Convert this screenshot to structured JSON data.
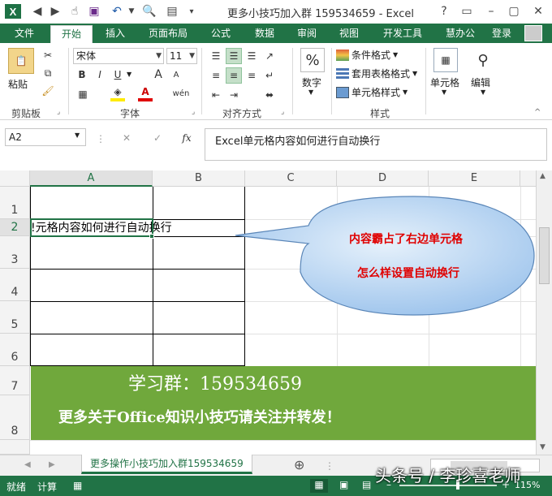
{
  "app": {
    "logo": "X",
    "title": "更多小技巧加入群 159534659 - Excel",
    "window_buttons": [
      "?",
      "▭",
      "–",
      "▢",
      "✕"
    ]
  },
  "tabs": [
    "文件",
    "开始",
    "插入",
    "页面布局",
    "公式",
    "数据",
    "审阅",
    "视图",
    "开发工具",
    "慧办公"
  ],
  "active_tab": "开始",
  "account": {
    "login": "登录"
  },
  "ribbon": {
    "clipboard": {
      "paste": "粘贴",
      "group": "剪贴板"
    },
    "font": {
      "name": "宋体",
      "size": "11",
      "bold": "B",
      "italic": "I",
      "underline": "U",
      "grow": "A",
      "shrink": "A",
      "phonetic": "wén",
      "group": "字体"
    },
    "alignment": {
      "group": "对齐方式"
    },
    "number": {
      "label": "数字",
      "icon_text": "%"
    },
    "styles": {
      "conditional": "条件格式",
      "table": "套用表格格式",
      "cell_styles": "单元格样式",
      "group": "样式"
    },
    "cells": {
      "label": "单元格"
    },
    "editing": {
      "label": "编辑"
    }
  },
  "formula_bar": {
    "name_box": "A2",
    "cancel": "✕",
    "enter": "✓",
    "fx": "fx",
    "content": "Excel单元格内容如何进行自动换行"
  },
  "grid": {
    "columns": [
      "A",
      "B",
      "C",
      "D",
      "E"
    ],
    "rows": [
      "1",
      "2",
      "3",
      "4",
      "5",
      "6",
      "7",
      "8"
    ],
    "a2_visible_text": "!元格内容如何进行自动换行",
    "banner_line1": "学习群：159534659",
    "banner_line2": "更多关于Office知识小技巧请关注并转发！"
  },
  "callout": {
    "line1": "内容霸占了右边单元格",
    "line2": "怎么样设置自动换行"
  },
  "sheet_tabs": {
    "active": "更多操作小技巧加入群159534659",
    "add": "⊕"
  },
  "status": {
    "ready": "就绪",
    "calc": "计算",
    "zoom": "115%"
  },
  "watermark": "头条号 / 李珍喜老师",
  "colors": {
    "excel_green": "#217346",
    "banner_green": "#70a83c",
    "callout_fill": "#a9cdf0",
    "callout_text": "#e00000",
    "banner_text": "#ffffff"
  }
}
